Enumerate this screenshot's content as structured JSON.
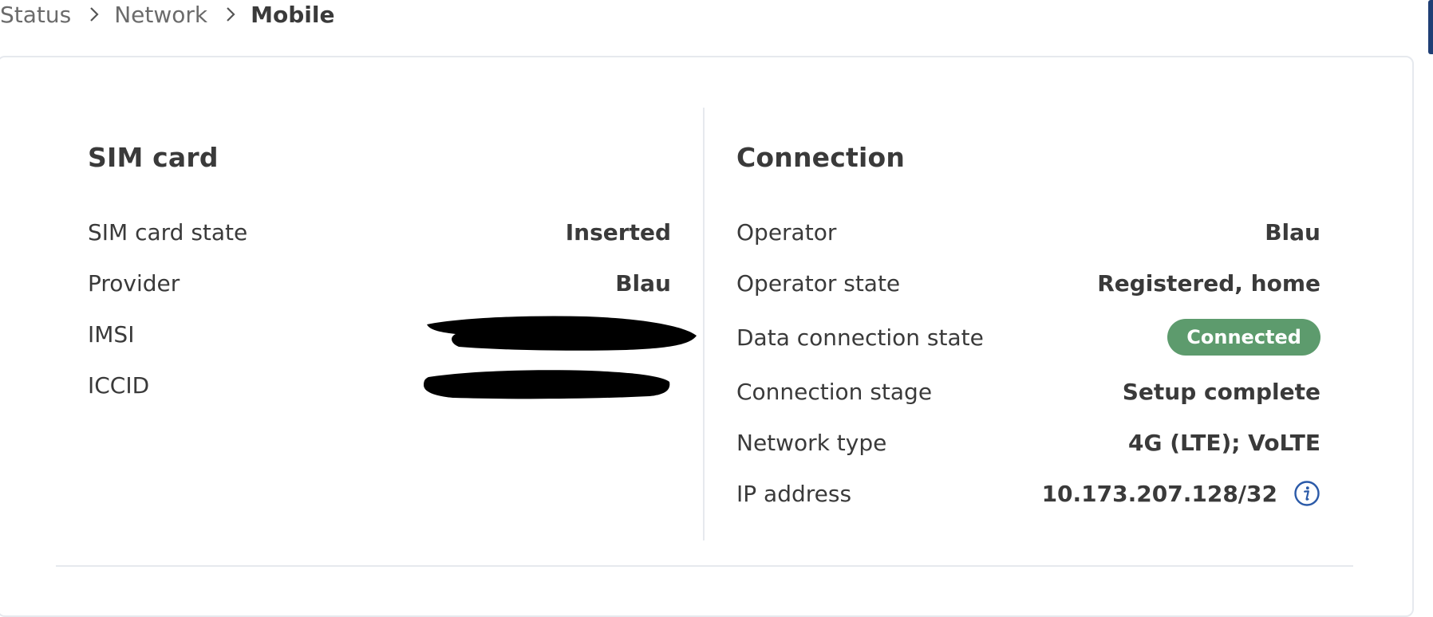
{
  "breadcrumb": {
    "items": [
      "Status",
      "Network",
      "Mobile"
    ]
  },
  "sim_card": {
    "title": "SIM card",
    "rows": [
      {
        "label": "SIM card state",
        "value": "Inserted"
      },
      {
        "label": "Provider",
        "value": "Blau"
      },
      {
        "label": "IMSI",
        "value": ""
      },
      {
        "label": "ICCID",
        "value": ""
      }
    ]
  },
  "connection": {
    "title": "Connection",
    "rows": [
      {
        "label": "Operator",
        "value": "Blau"
      },
      {
        "label": "Operator state",
        "value": "Registered, home"
      },
      {
        "label": "Data connection state",
        "value": "Connected"
      },
      {
        "label": "Connection stage",
        "value": "Setup complete"
      },
      {
        "label": "Network type",
        "value": "4G (LTE); VoLTE"
      },
      {
        "label": "IP address",
        "value": "10.173.207.128/32"
      }
    ]
  },
  "colors": {
    "accent": "#1f3f75",
    "status_connected": "#5d9b6d",
    "info_icon": "#2b5aa8"
  },
  "icons": {
    "breadcrumb_separator": "chevron-right-icon",
    "ip_info": "info-icon"
  }
}
